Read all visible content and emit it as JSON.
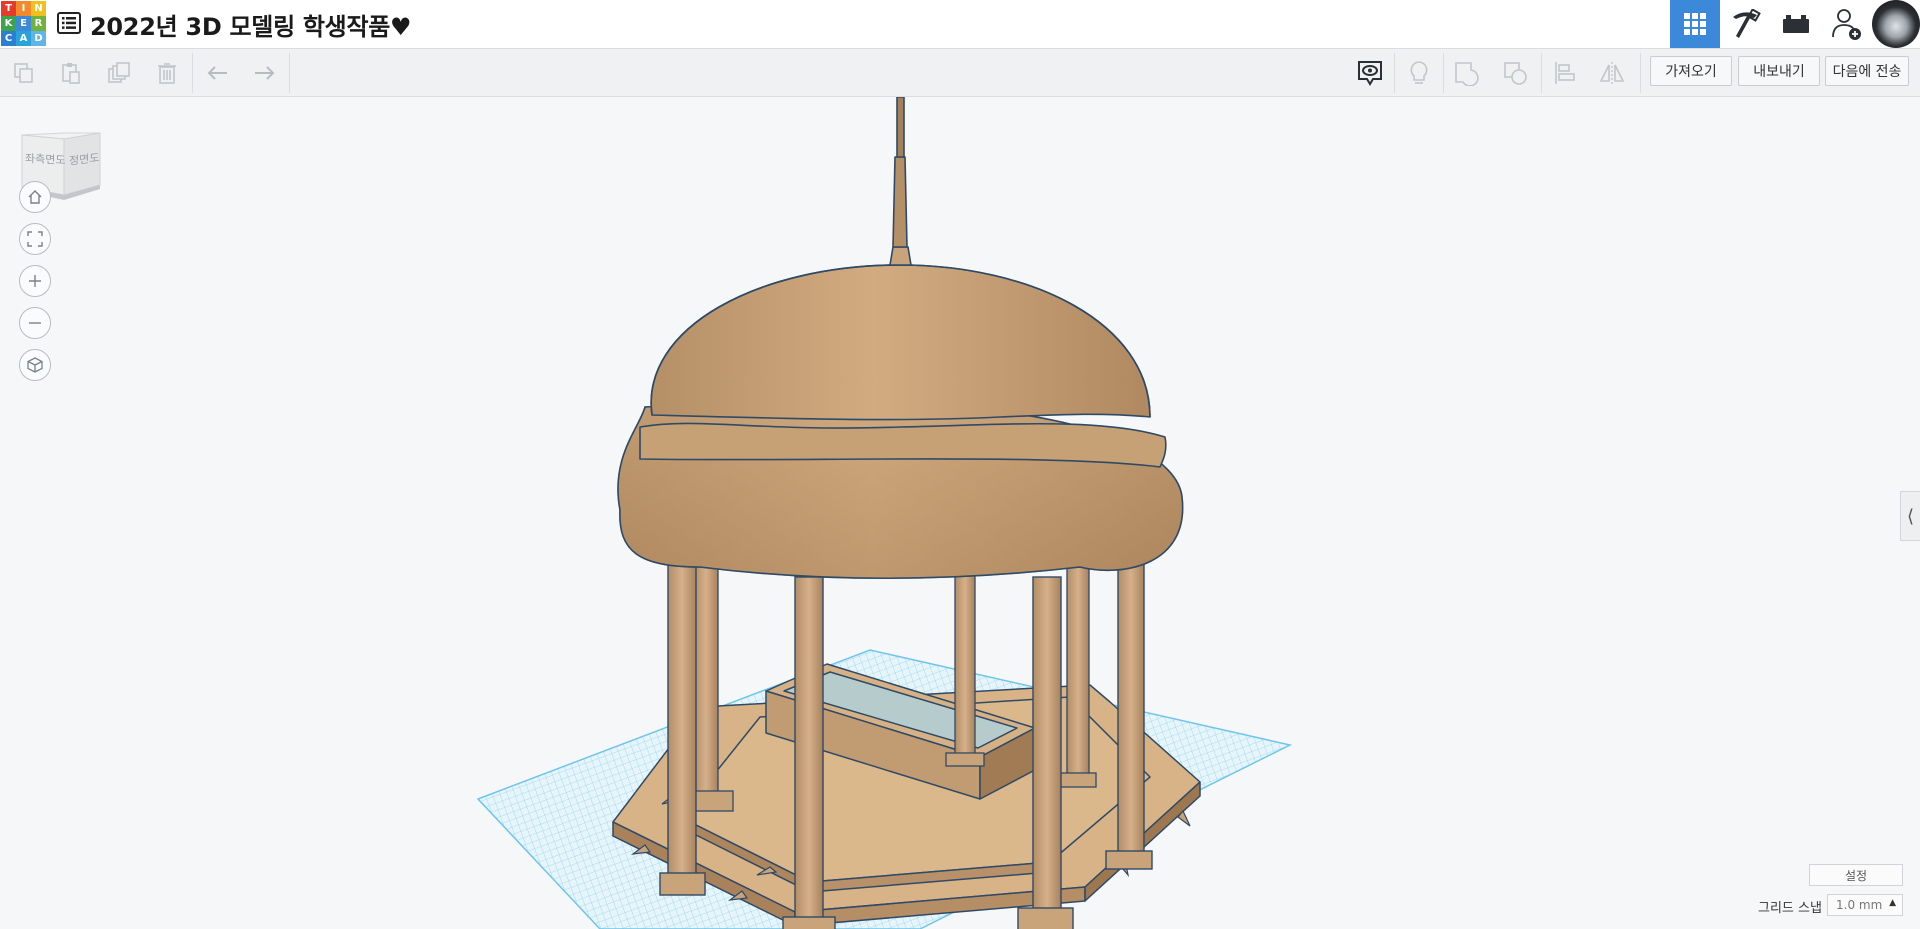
{
  "app": {
    "logo_letters": [
      "T",
      "I",
      "N",
      "K",
      "E",
      "R",
      "C",
      "A",
      "D"
    ],
    "logo_colors": [
      "#e53b2c",
      "#f18a2b",
      "#f0c020",
      "#3fa34d",
      "#3c89d9",
      "#6fb23d",
      "#2a7fd4",
      "#29a3d9",
      "#5fb5e5"
    ],
    "design_title": "2022년 3D 모델링 학생작품♥"
  },
  "top_right": {
    "icons": [
      "grid-view-icon",
      "pickaxe-icon",
      "bricks-icon",
      "add-user-icon"
    ],
    "active_color": "#3c89d9"
  },
  "toolbar": {
    "import_label": "가져오기",
    "export_label": "내보내기",
    "send_label": "다음에 전송"
  },
  "viewcube": {
    "left_face": "좌측면도",
    "right_face": "정면도"
  },
  "bottom_right": {
    "settings_label": "설정",
    "grid_snap_label": "그리드 스냅",
    "grid_snap_value": "1.0 mm"
  },
  "colors": {
    "model": "#d8ae82",
    "model_outline": "#2f4a66",
    "workplane_grid": "#7fd0ee",
    "water": "#b6cccc"
  }
}
